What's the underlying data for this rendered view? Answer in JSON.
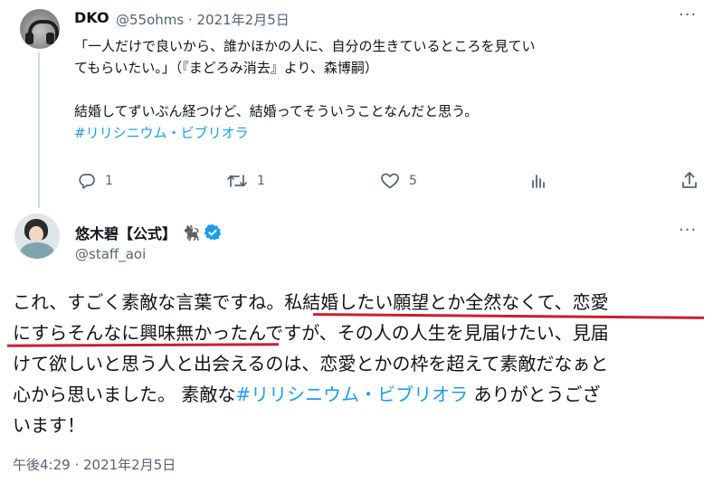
{
  "reply": {
    "display_name": "DKO",
    "handle_date": "@55ohms · 2021年2月5日",
    "more_icon": "more-icon",
    "lines": [
      "「一人だけで良いから、誰かほかの人に、自分の生きているところを見てい",
      "てもらいたい。」（『まどろみ消去』より、森博嗣）",
      "",
      "結婚してずいぶん経つけど、結婚ってそういうことなんだと思う。"
    ],
    "hashtag": "#リリシニウム・ビブリオラ",
    "actions": {
      "reply_count": "1",
      "retweet_count": "1",
      "like_count": "5"
    }
  },
  "main": {
    "display_name": "悠木碧【公式】",
    "cat_emoji": "🐈‍⬛",
    "handle": "@staff_aoi",
    "body": {
      "line1_a": "これ、すごく素敵な言葉ですね。",
      "line1_b": "私結婚したい願望とか全然なくて、恋愛",
      "line2_a": "にすらそんなに興味無かったん",
      "line2_b": "ですが、その人の人生を見届けたい、見届",
      "line3": "けて欲しいと思う人と出会えるのは、恋愛とかの枠を超えて素敵だなぁと",
      "line4_a": "心から思いました。 素敵な",
      "line4_hashtag": "#リリシニウム・ビブリオラ",
      "line4_b": " ありがとうござ",
      "line5": "います！"
    },
    "timestamp": "午後4:29 · 2021年2月5日"
  },
  "colors": {
    "text": "#0f1419",
    "secondary": "#536471",
    "link": "#1d9bf0",
    "verified": "#1d9bf0",
    "underline": "#c8202f"
  }
}
